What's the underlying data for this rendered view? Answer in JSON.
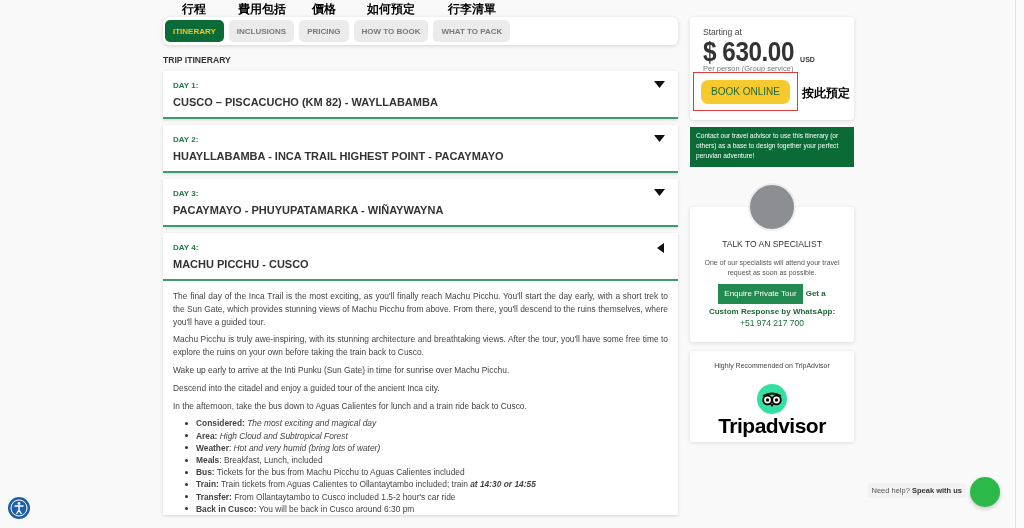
{
  "tabs": [
    {
      "label": "ITINERARY",
      "selected": true,
      "annotation": "行程"
    },
    {
      "label": "INCLUSIONS",
      "selected": false,
      "annotation": "費用包括"
    },
    {
      "label": "PRICING",
      "selected": false,
      "annotation": "價格"
    },
    {
      "label": "HOW TO BOOK",
      "selected": false,
      "annotation": "如何預定"
    },
    {
      "label": "WHAT TO PACK",
      "selected": false,
      "annotation": "行李清單"
    }
  ],
  "section_title": "TRIP ITINERARY",
  "days": [
    {
      "label": "DAY 1:",
      "title": "CUSCO – PISCACUCHO (KM 82) - WAYLLABAMBA",
      "expanded": false
    },
    {
      "label": "DAY 2:",
      "title": "HUAYLLABAMBA - INCA TRAIL HIGHEST POINT - PACAYMAYO",
      "expanded": false
    },
    {
      "label": "DAY 3:",
      "title": "PACAYMAYO - PHUYUPATAMARKA - WIÑAYWAYNA",
      "expanded": false
    },
    {
      "label": "DAY 4:",
      "title": "MACHU PICCHU - CUSCO",
      "expanded": true,
      "paragraphs": [
        "The final day of the Inca Trail is the most exciting, as you'll finally reach Machu Picchu. You'll start the day early, with a short trek to the Sun Gate, which provides stunning views of Machu Picchu from above. From there, you'll descend to the ruins themselves, where you'll have a guided tour.",
        "Machu Picchu is truly awe-inspiring, with its stunning architecture and breathtaking views. After the tour, you'll have some free time to explore the ruins on your own before taking the train back to Cusco.",
        "Wake up early to arrive at the Inti Punku (Sun Gate) in time for sunrise over Machu Picchu.",
        "Descend into the citadel and enjoy a guided tour of the ancient Inca city.",
        "In the afternoon, take the bus down to Aguas Calientes for lunch and a train ride back to Cusco."
      ],
      "details": [
        "**Considered:** *The most exciting and magical day*",
        "**Area:** *High Cloud and Subtropical Forest*",
        "**Weather**: *Hot and very humid (bring lots of water)*",
        "**Meals**: Breakfast, Lunch, included",
        "**Bus:** Tickets for the bus from Machu Picchu to Aguas Calientes included",
        "**Train:** Train tickets from Aguas Calientes to Ollantaytambo included; train **at 14:30 or 14:55**",
        "**Transfer:** From Ollantaytambo to Cusco included 1.5-2 hour's car ride",
        "**Back in Cusco:** You will be back in Cusco around 6:30 pm"
      ]
    }
  ],
  "sidebar": {
    "price": {
      "caption": "Starting at",
      "amount": "$ 630.00",
      "currency": "USD",
      "note": "Per person (Group service)",
      "button": "BOOK ONLINE",
      "annotation": "按此預定"
    },
    "advisor_note": "Contact our travel advisor to use this itinerary (or others) as a base to design together your perfect peruvian adventure!",
    "specialist": {
      "title": "TALK TO AN SPECIALIST",
      "text": "One of our specialists will attend your travel request as soon as possible.",
      "button": "Enquire Private Tour",
      "whatsapp_lead": "Get a",
      "whatsapp": "Custom Response by WhatsApp:",
      "phone": "+51 974 217 700"
    },
    "tripadvisor": {
      "caption": "Highly Recommended on TripAdvisor",
      "logo": "Tripadvisor"
    }
  },
  "chat": {
    "prompt": "Need help?",
    "action": "Speak with us"
  }
}
